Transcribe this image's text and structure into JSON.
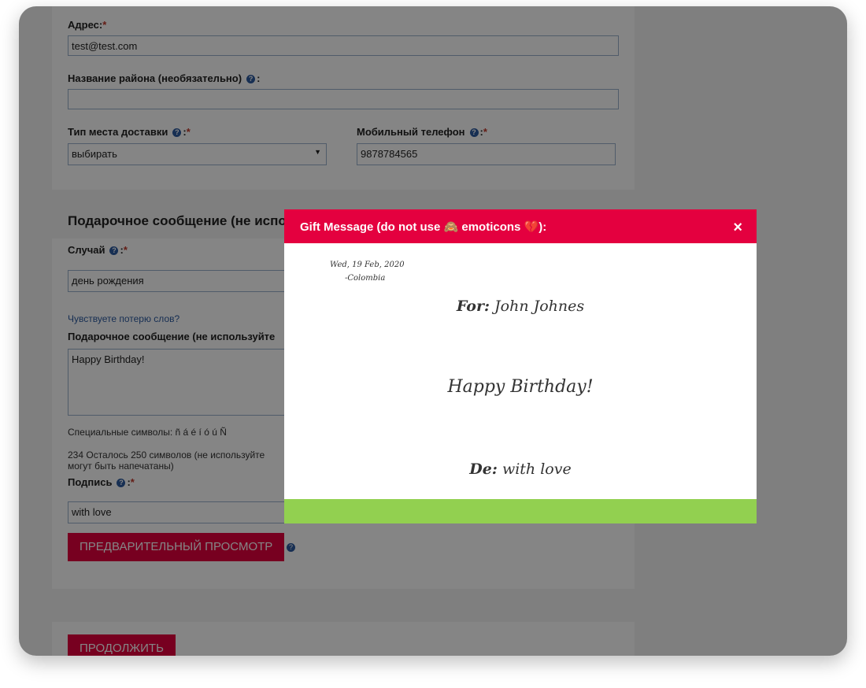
{
  "form": {
    "address_label": "Адрес:",
    "address_value": "test@test.com",
    "district_label": "Название района (необязательно)",
    "delivery_type_label": "Тип места доставки",
    "delivery_type_value": "выбирать",
    "phone_label": "Мобильный телефон",
    "phone_value": "9878784565",
    "gift_section_title": "Подарочное сообщение (не испо",
    "occasion_label": "Случай",
    "occasion_value": "день рождения",
    "lost_words_link": "Чувствуете потерю слов?",
    "message_label": "Подарочное сообщение (не используйте",
    "message_value": "Happy Birthday!",
    "special_chars": "Специальные символы: ñ á é í ó ú Ñ",
    "remaining": "234 Осталось 250 символов (не используйте",
    "remaining_2": "могут быть напечатаны)",
    "signature_label": "Подпись",
    "signature_value": "with love",
    "preview_button": "ПРЕДВАРИТЕЛЬНЫЙ ПРОСМОТР",
    "continue_button": "ПРОДОЛЖИТЬ"
  },
  "modal": {
    "title": "Gift Message (do not use 🙈 emoticons 💔):",
    "close": "×",
    "date": "Wed, 19 Feb, 2020",
    "place": "-Colombia",
    "for_label": "For:",
    "for_value": "John Johnes",
    "message": "Happy Birthday!",
    "from_label": "De:",
    "from_value": "with love"
  },
  "colors": {
    "accent": "#e4003f",
    "footer": "#92d050"
  }
}
